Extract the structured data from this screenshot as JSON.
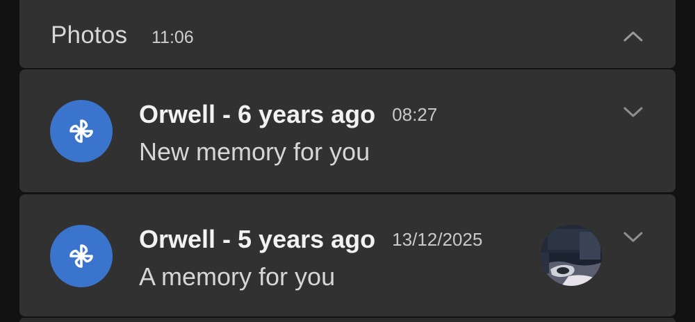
{
  "group": {
    "app_name": "Photos",
    "time": "11:06",
    "chevron_icon": "chevron-up-icon"
  },
  "notifications": [
    {
      "icon": "pinwheel-icon",
      "title": "Orwell - 6 years ago",
      "time": "08:27",
      "body": "New memory for you",
      "chevron_icon": "chevron-down-icon"
    },
    {
      "icon": "pinwheel-icon",
      "title": "Orwell - 5 years ago",
      "time": "13/12/2025",
      "body": "A memory for you",
      "thumbnail": "memory-photo-thumbnail",
      "chevron_icon": "chevron-down-icon"
    }
  ],
  "colors": {
    "background": "#121212",
    "card": "#313131",
    "icon_circle": "#3b74cc",
    "title_text": "#f2f2f2",
    "body_text": "#d6d6d6"
  }
}
